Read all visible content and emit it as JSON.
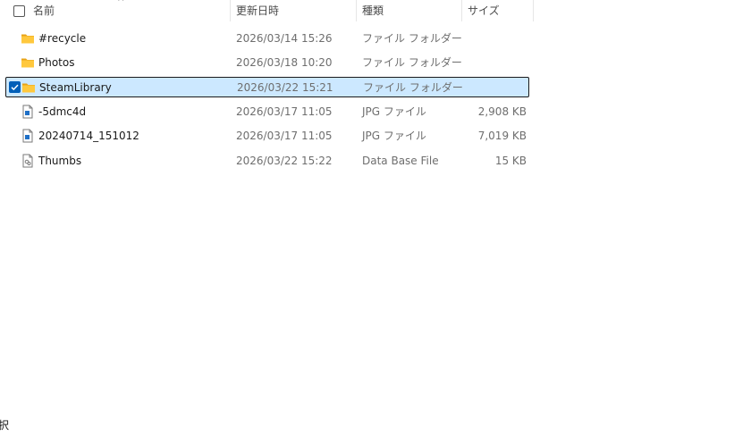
{
  "header": {
    "sort_arrow": "^",
    "col_name": "名前",
    "col_date": "更新日時",
    "col_type": "種類",
    "col_size": "サイズ"
  },
  "files": [
    {
      "name": "#recycle",
      "date": "2026/03/14 15:26",
      "type": "ファイル フォルダー",
      "size": "",
      "icon": "folder-icon",
      "selected": false
    },
    {
      "name": "Photos",
      "date": "2026/03/18 10:20",
      "type": "ファイル フォルダー",
      "size": "",
      "icon": "folder-icon",
      "selected": false
    },
    {
      "name": "SteamLibrary",
      "date": "2026/03/22 15:21",
      "type": "ファイル フォルダー",
      "size": "",
      "icon": "folder-icon",
      "selected": true
    },
    {
      "name": "-5dmc4d",
      "date": "2026/03/17 11:05",
      "type": "JPG ファイル",
      "size": "2,908 KB",
      "icon": "image-file-icon",
      "selected": false
    },
    {
      "name": "20240714_151012",
      "date": "2026/03/17 11:05",
      "type": "JPG ファイル",
      "size": "7,019 KB",
      "icon": "image-file-icon",
      "selected": false
    },
    {
      "name": "Thumbs",
      "date": "2026/03/22 15:22",
      "type": "Data Base File",
      "size": "15 KB",
      "icon": "database-file-icon",
      "selected": false
    }
  ],
  "status": {
    "fragment": "択"
  },
  "colors": {
    "selection_bg": "#cce8ff",
    "check_blue": "#005fb8",
    "folder_yellow": "#ffc83d"
  }
}
